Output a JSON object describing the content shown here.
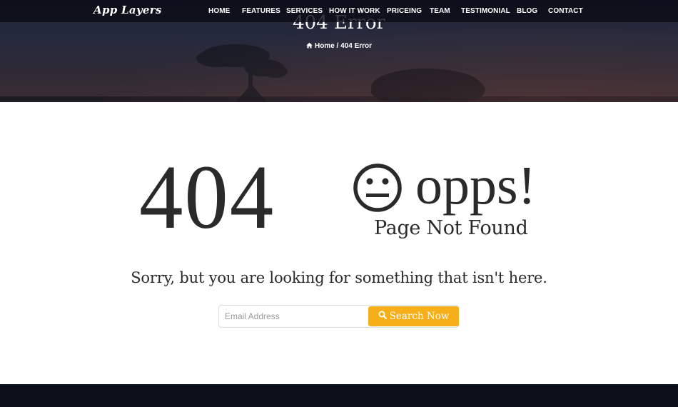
{
  "header": {
    "logo": "App Layers",
    "nav": [
      "HOME",
      "FEATURES",
      "SERVICES",
      "HOW IT WORK",
      "PRICEING",
      "TEAM",
      "TESTIMONIAL",
      "BLOG",
      "CONTACT"
    ]
  },
  "hero": {
    "title": "404 Error",
    "breadcrumb": {
      "home": "Home",
      "separator": "/",
      "current": "404 Error"
    }
  },
  "error": {
    "code": "404",
    "opps": "opps!",
    "subtitle": "Page Not Found",
    "message": "Sorry, but you are looking for something that isn't here."
  },
  "search": {
    "placeholder": "Email Address",
    "button_label": "Search Now"
  },
  "colors": {
    "accent": "#f6ae19",
    "text": "#2a2a2a",
    "nav_bg": "#0a0c16",
    "footer_bg": "#0a0f1a"
  },
  "icons": {
    "home": "home-icon",
    "face": "neutral-face-icon",
    "search": "search-icon"
  }
}
